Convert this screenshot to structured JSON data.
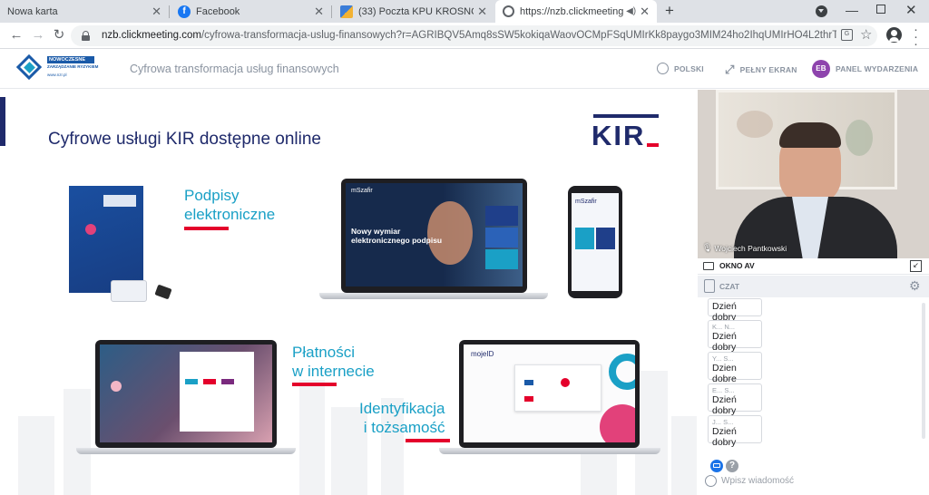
{
  "browser": {
    "tabs": [
      {
        "title": "Nowa karta",
        "close": "✕"
      },
      {
        "title": "Facebook",
        "close": "✕"
      },
      {
        "title": "(33) Poczta KPU KROSNO :: Odeb",
        "close": "✕"
      },
      {
        "title": "https://nzb.clickmeeting.com",
        "close": "✕",
        "active": true
      }
    ],
    "new_tab": "+",
    "url_host": "nzb.clickmeeting.com",
    "url_path": "/cyfrowa-transformacja-uslug-finansowych?r=AGRIBQV5Amq8sSW5kokiqaWaovOCMpFSqUMIrKk8paygo3MIM24ho2IhqUMIrHO4L2thrTIvMzSvYzA5sU...",
    "colors": {
      "facebook": "#1877f2",
      "active_tab": "#ffffff",
      "strip": "#dee1e6"
    }
  },
  "app": {
    "logo": {
      "line1": "NOWOCZESNE",
      "line2": "ZARZĄDZANIE RYZYKIEM",
      "line3": "www.nzr.pl"
    },
    "event_title": "Cyfrowa transformacja usług finansowych",
    "language": "POLSKI",
    "fullscreen": "PEŁNY EKRAN",
    "user_initials": "EB",
    "event_panel": "PANEL WYDARZENIA",
    "accent": "#8e44ad"
  },
  "slide": {
    "heading": "Cyfrowe usługi KIR dostępne online",
    "logo": "KIR",
    "label_signatures": "Podpisy\nelektroniczne",
    "label_payments": "Płatności\nw internecie",
    "label_identity": "Identyfikacja\ni tożsamość",
    "laptop_title": "Nowy wymiar\nelektronicznego podpisu",
    "laptop_brand": "mSzafir",
    "phone_brand": "mSzafir",
    "mojeid": "mojeID",
    "colors": {
      "navy": "#1f2a6b",
      "cyan": "#1aa0c6",
      "red": "#e4002b"
    }
  },
  "video": {
    "speaker": "Wojciech Pantkowski",
    "av_window": "OKNO AV"
  },
  "chat": {
    "title": "CZAT",
    "messages": [
      {
        "author": "",
        "text": "Dzień dobry"
      },
      {
        "author": "K... N...",
        "text": "Dzień dobry"
      },
      {
        "author": "Y... S...",
        "text": "Dzien dobre"
      },
      {
        "author": "E... S...",
        "text": "Dzień dobry"
      },
      {
        "author": "J... S...",
        "text": "Dzień dobry"
      }
    ],
    "input_placeholder": "Wpisz wiadomość",
    "help_icon": "?"
  }
}
